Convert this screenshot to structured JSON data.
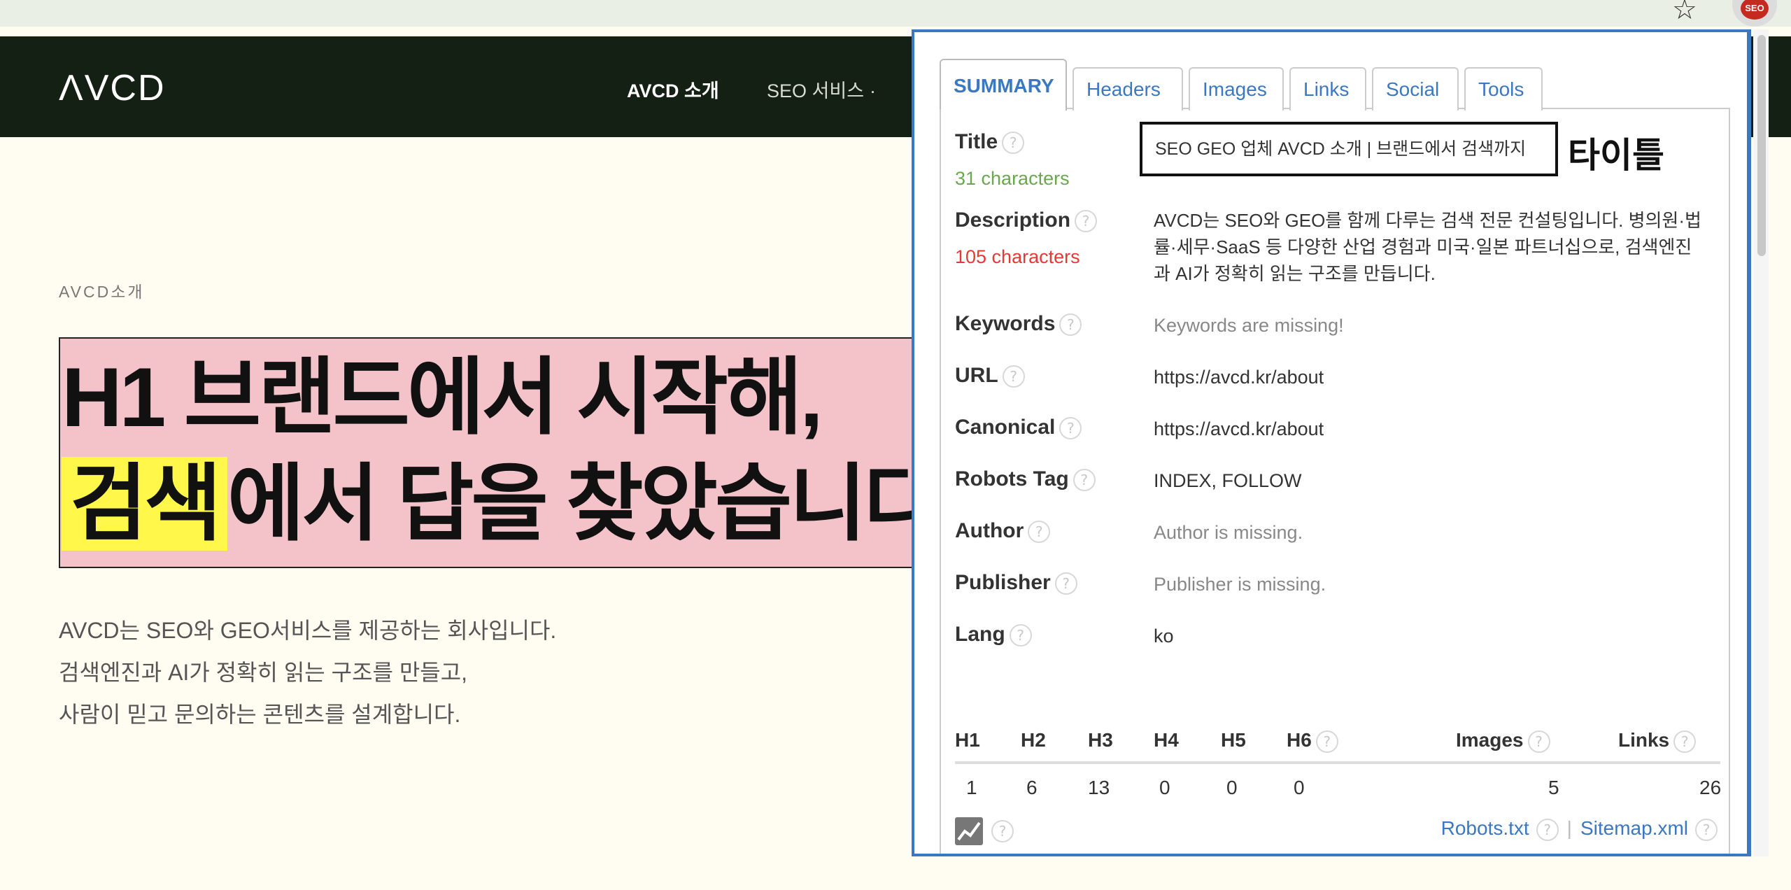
{
  "browser": {
    "bookmark_icon": "star-icon",
    "extension_badge": "SEO"
  },
  "site": {
    "logo": "ΛVCD",
    "nav": {
      "about": "AVCD 소개",
      "seo_services": "SEO 서비스"
    },
    "eyebrow": "AVCD소개",
    "h1_line1": "H1 브랜드에서 시작해,",
    "h1_highlight": "검색",
    "h1_line2_rest": "에서 답을 찾았습니다",
    "desc_lines": [
      "AVCD는 SEO와 GEO서비스를 제공하는 회사입니다.",
      "검색엔진과 AI가 정확히 읽는 구조를 만들고,",
      "사람이 믿고 문의하는 콘텐츠를 설계합니다."
    ]
  },
  "panel": {
    "tabs": [
      "SUMMARY",
      "Headers",
      "Images",
      "Links",
      "Social",
      "Tools"
    ],
    "active_tab": "SUMMARY",
    "help_glyph": "?",
    "title": {
      "label": "Title",
      "count": "31 characters",
      "value": "SEO GEO 업체 AVCD 소개 | 브랜드에서 검색까지",
      "annotation": "타이틀"
    },
    "description": {
      "label": "Description",
      "count": "105 characters",
      "value": "AVCD는 SEO와 GEO를 함께 다루는 검색 전문 컨설팅입니다. 병의원·법률·세무·SaaS 등 다양한 산업 경험과 미국·일본 파트너십으로, 검색엔진과 AI가 정확히 읽는 구조를 만듭니다."
    },
    "keywords": {
      "label": "Keywords",
      "value": "Keywords are missing!"
    },
    "url": {
      "label": "URL",
      "value": "https://avcd.kr/about"
    },
    "canonical": {
      "label": "Canonical",
      "value": "https://avcd.kr/about"
    },
    "robots": {
      "label": "Robots Tag",
      "value": "INDEX, FOLLOW"
    },
    "author": {
      "label": "Author",
      "value": "Author is missing."
    },
    "publisher": {
      "label": "Publisher",
      "value": "Publisher is missing."
    },
    "lang": {
      "label": "Lang",
      "value": "ko"
    },
    "headings_table": {
      "headers": [
        "H1",
        "H2",
        "H3",
        "H4",
        "H5",
        "H6",
        "Images",
        "Links"
      ],
      "values": [
        "1",
        "6",
        "13",
        "0",
        "0",
        "0",
        "5",
        "26"
      ]
    },
    "footer_links": {
      "robots": "Robots.txt",
      "separator": "|",
      "sitemap": "Sitemap.xml"
    },
    "colors": {
      "accent": "#3b78c2",
      "ok": "#6aa84f",
      "warning": "#e53935",
      "highlight_pink": "#f4c3ca",
      "highlight_yellow": "#fff84a"
    }
  }
}
